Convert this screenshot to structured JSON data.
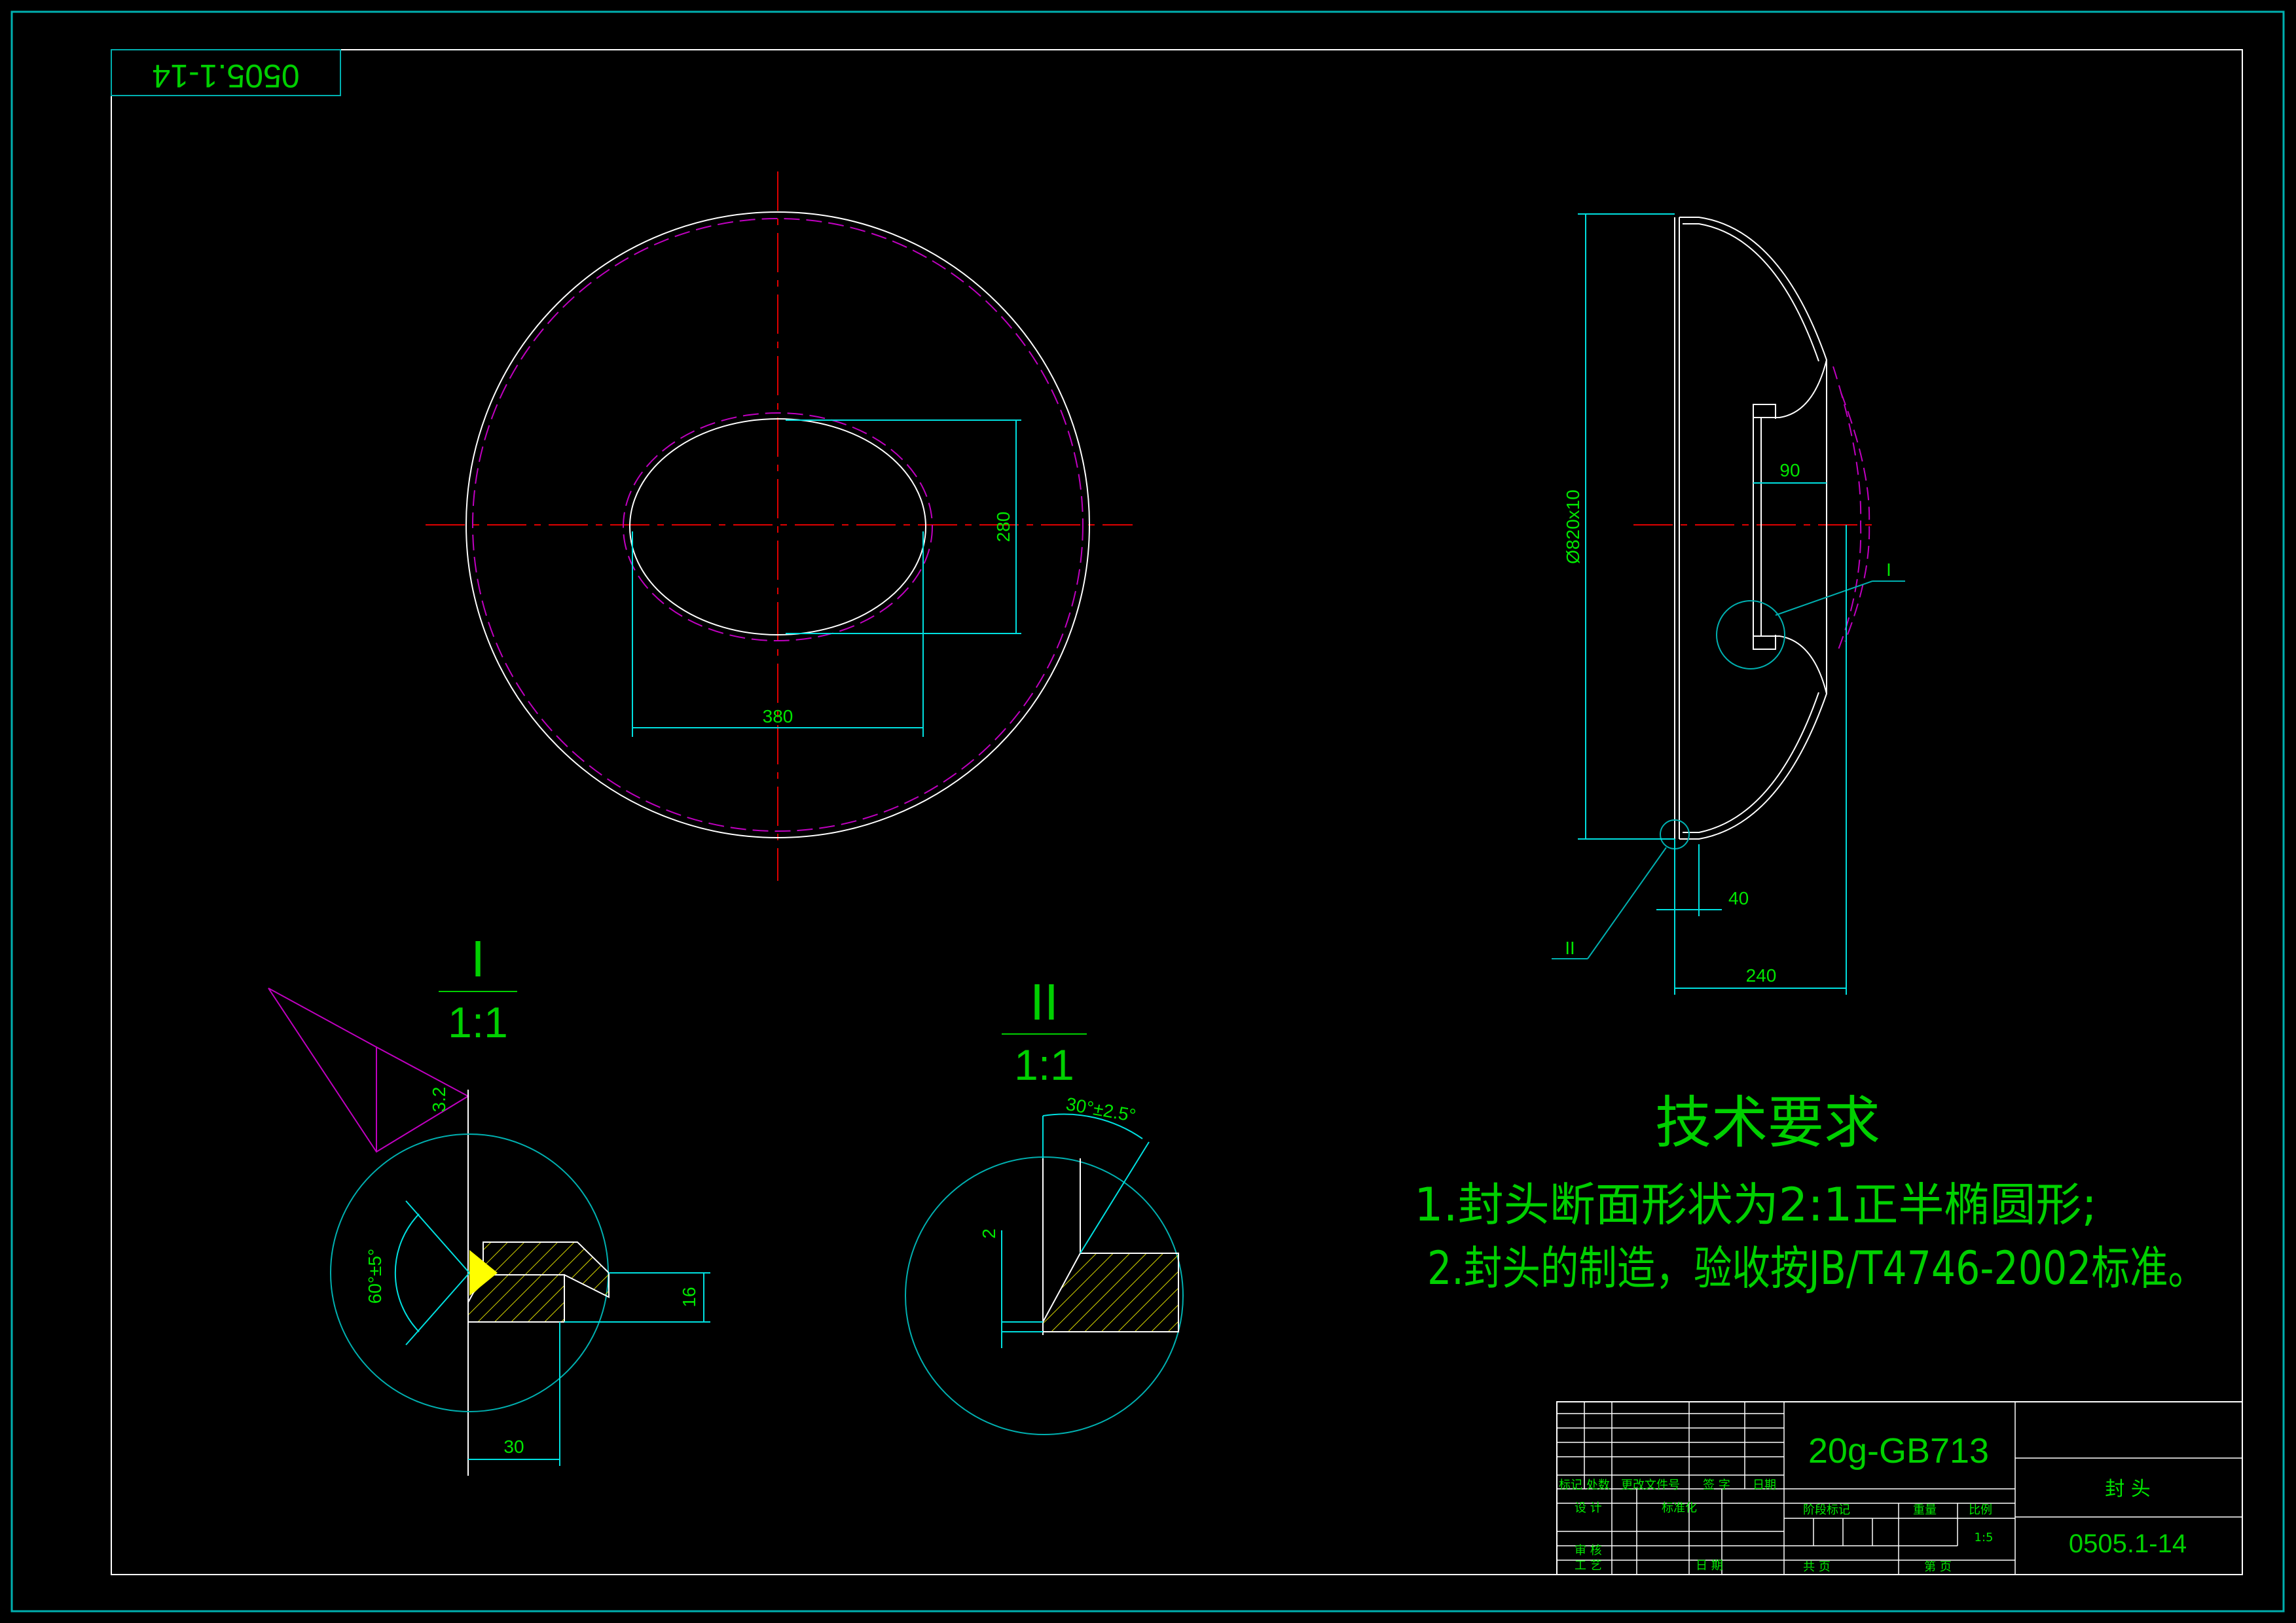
{
  "drawing": {
    "number": "0505.1-14",
    "number_mirrored": "0505.1-14",
    "scale": "1:5",
    "part_name": "封 头",
    "material": "20g-GB713"
  },
  "dimensions": {
    "front_width": "380",
    "front_height": "280",
    "side_diameter": "Ø820x10",
    "side_depth": "90",
    "side_flange": "40",
    "side_length": "240"
  },
  "detail_labels": {
    "one": "I",
    "two": "II",
    "one_marker": "I",
    "two_marker": "II"
  },
  "detail_one": {
    "roman": "I",
    "scale": "1:1",
    "roughness": "3.2",
    "angle": "60°±5°",
    "thickness": "16",
    "width": "30"
  },
  "detail_two": {
    "roman": "II",
    "scale": "1:1",
    "angle": "30°±2.5°",
    "gap": "2"
  },
  "technical_requirements": {
    "title": "技术要求",
    "item1": "1.封头断面形状为2:1正半椭圆形;",
    "item2": "2.封头的制造，验收按JB/T4746-2002标准。"
  },
  "title_block": {
    "row_labels": [
      "标记",
      "处数",
      "更改文件号",
      "签 字",
      "日期"
    ],
    "design": "设 计",
    "standardize": "标准化",
    "review": "审 核",
    "process": "工 艺",
    "date": "日 期",
    "stage_mark": "阶段标记",
    "weight": "重量",
    "scale_label": "比例",
    "sheets_total": "共 页",
    "sheet_no": "第 页"
  },
  "colors": {
    "background": "#000000",
    "border": "#00b0b0",
    "geometry": "#ffffff",
    "dimension": "#00e0e0",
    "hidden": "#c000c0",
    "center": "#e00000",
    "text": "#00e600",
    "hatch": "#d8d800",
    "weld": "#ffff00"
  }
}
